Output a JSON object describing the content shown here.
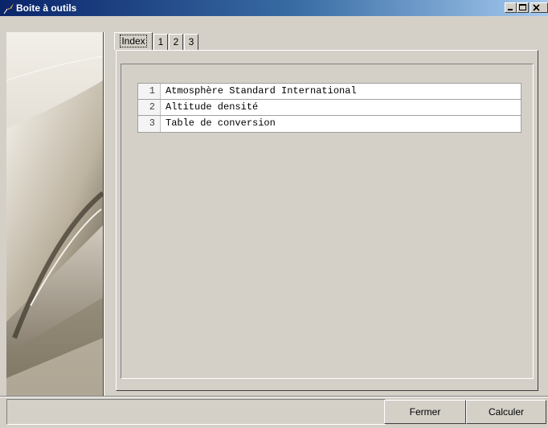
{
  "window": {
    "title": "Boite à outils",
    "app_icon": "feather-icon",
    "controls": [
      "minimize-icon",
      "maximize-icon",
      "close-icon"
    ]
  },
  "tabs": [
    {
      "label": "Index",
      "active": true
    },
    {
      "label": "1",
      "active": false
    },
    {
      "label": "2",
      "active": false
    },
    {
      "label": "3",
      "active": false
    }
  ],
  "index": {
    "items": [
      {
        "number": "1",
        "label": "Atmosphère Standard International"
      },
      {
        "number": "2",
        "label": "Altitude densité"
      },
      {
        "number": "3",
        "label": "Table de conversion"
      }
    ]
  },
  "footer": {
    "close_label": "Fermer",
    "compute_label": "Calculer"
  },
  "colors": {
    "titlebar_start": "#0a246a",
    "titlebar_end": "#a6caf0",
    "window_face": "#d4d0c8"
  }
}
